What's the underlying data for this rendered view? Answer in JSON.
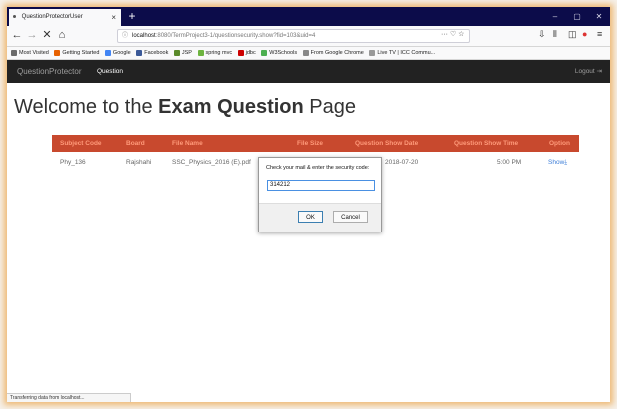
{
  "browser": {
    "tab_title": "QuestionProtectorUser",
    "tab_close": "×",
    "new_tab": "+",
    "window_controls": {
      "minimize": "–",
      "restore": "▢",
      "close": "✕"
    },
    "url": {
      "host": "localhost",
      "path": ":8080/TermProject3-1/questionsecurity.show?fid=103&uid=4"
    },
    "url_actions": "··· ♡ ☆",
    "bookmarks": [
      {
        "label": "Most Visited",
        "color": "#6b6b6b"
      },
      {
        "label": "Getting Started",
        "color": "#e66000"
      },
      {
        "label": "Google",
        "color": "#4285f4"
      },
      {
        "label": "Facebook",
        "color": "#3b5998"
      },
      {
        "label": "JSP",
        "color": "#5a8a2a"
      },
      {
        "label": "spring mvc",
        "color": "#6db33f"
      },
      {
        "label": "jdbc",
        "color": "#cc0000"
      },
      {
        "label": "W3Schools",
        "color": "#4caf50"
      },
      {
        "label": "From Google Chrome",
        "color": "#888888"
      },
      {
        "label": "Live TV | ICC Commu...",
        "color": "#999999"
      }
    ],
    "status_text": "Transferring data from localhost..."
  },
  "app": {
    "brand": "QuestionProtector",
    "nav_link": "Question",
    "logout": "Logout"
  },
  "page": {
    "heading_pre": "Welcome to the ",
    "heading_bold": "Exam Question",
    "heading_post": " Page"
  },
  "table": {
    "headers": {
      "subject_code": "Subject Code",
      "board": "Board",
      "file_name": "File Name",
      "file_size": "File Size",
      "show_date": "Question Show Date",
      "show_time": "Question Show Time",
      "option": "Option"
    },
    "rows": [
      {
        "subject_code": "Phy_136",
        "board": "Rajshahi",
        "file_name": "SSC_Physics_2016 (E).pdf",
        "show_date": "2018-07-20",
        "show_time": "5:00 PM",
        "option": "Show"
      }
    ]
  },
  "dialog": {
    "message": "Check your mail & enter the security code:",
    "input_value": "314212",
    "ok_label": "OK",
    "cancel_label": "Cancel"
  },
  "colors": {
    "title_bar": "#0c0c4a",
    "app_nav": "#222222",
    "table_header": "#c8492e",
    "table_header_text": "#ff9a7a",
    "link": "#3b7dd8"
  }
}
